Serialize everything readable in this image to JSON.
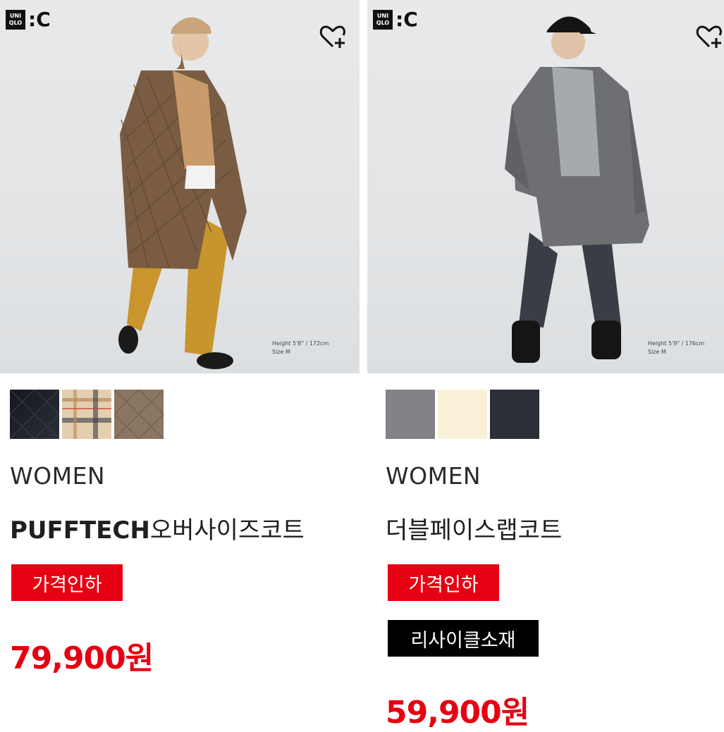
{
  "products": [
    {
      "brand_logo": {
        "box_text": "UNI QLO",
        "mark": ":C"
      },
      "fit_info": {
        "height": "Height 5'8\" / 172cm",
        "size": "Size M"
      },
      "swatch_colors": [
        "#1c1f26",
        "#d9c3a3",
        "#8a7463"
      ],
      "gender": "WOMEN",
      "name_bold": "PUFFTECH",
      "name_rest": "오버사이즈코트",
      "tags": [
        "가격인하"
      ],
      "price": "79,900원"
    },
    {
      "brand_logo": {
        "box_text": "UNI QLO",
        "mark": ":C"
      },
      "fit_info": {
        "height": "Height 5'9\" / 176cm",
        "size": "Size M"
      },
      "swatch_colors": [
        "#808286",
        "#f7f0d8",
        "#2d3039"
      ],
      "gender": "WOMEN",
      "name_bold": "",
      "name_rest": "더블페이스랩코트",
      "tags": [
        "가격인하",
        "리사이클소재"
      ],
      "price": "59,900원"
    }
  ],
  "icons": {
    "wishlist": "heart-plus-icon"
  },
  "colors": {
    "sale_red": "#e60012",
    "tag_black": "#000000",
    "text_dark": "#1b1b1b"
  }
}
